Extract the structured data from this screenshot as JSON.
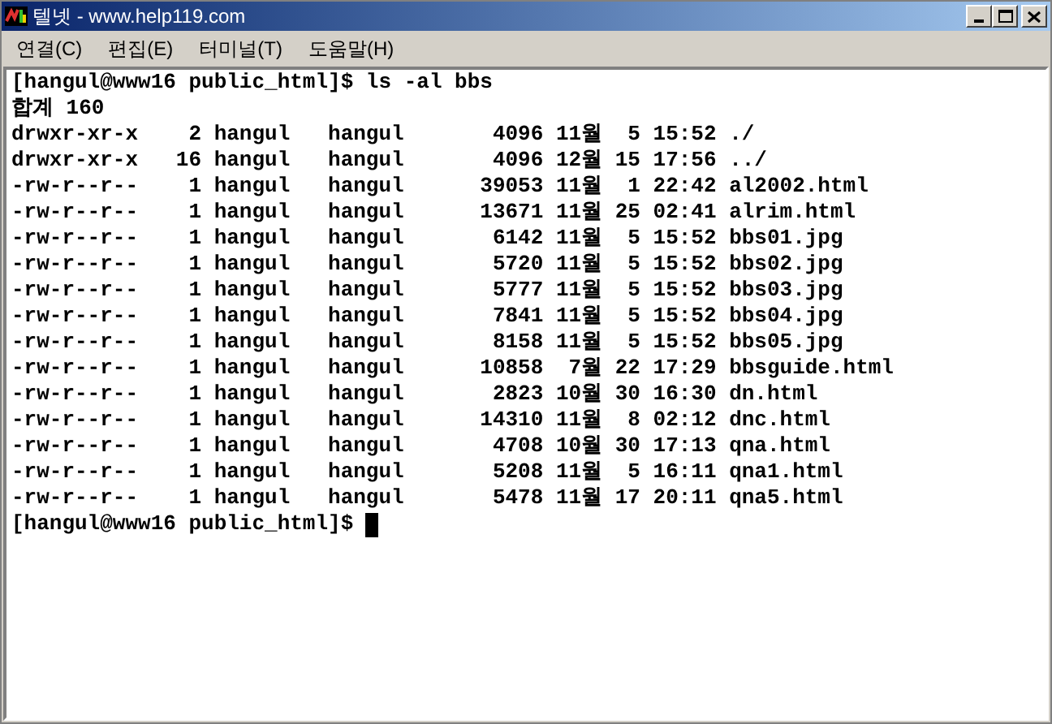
{
  "window": {
    "title": "텔넷 - www.help119.com"
  },
  "menu": [
    {
      "label": "연결(C)"
    },
    {
      "label": "편집(E)"
    },
    {
      "label": "터미널(T)"
    },
    {
      "label": "도움말(H)"
    }
  ],
  "terminal": {
    "lines": [
      "[hangul@www16 public_html]$ ls -al bbs",
      "합계 160",
      "drwxr-xr-x    2 hangul   hangul       4096 11월  5 15:52 ./",
      "drwxr-xr-x   16 hangul   hangul       4096 12월 15 17:56 ../",
      "-rw-r--r--    1 hangul   hangul      39053 11월  1 22:42 al2002.html",
      "-rw-r--r--    1 hangul   hangul      13671 11월 25 02:41 alrim.html",
      "-rw-r--r--    1 hangul   hangul       6142 11월  5 15:52 bbs01.jpg",
      "-rw-r--r--    1 hangul   hangul       5720 11월  5 15:52 bbs02.jpg",
      "-rw-r--r--    1 hangul   hangul       5777 11월  5 15:52 bbs03.jpg",
      "-rw-r--r--    1 hangul   hangul       7841 11월  5 15:52 bbs04.jpg",
      "-rw-r--r--    1 hangul   hangul       8158 11월  5 15:52 bbs05.jpg",
      "-rw-r--r--    1 hangul   hangul      10858  7월 22 17:29 bbsguide.html",
      "-rw-r--r--    1 hangul   hangul       2823 10월 30 16:30 dn.html",
      "-rw-r--r--    1 hangul   hangul      14310 11월  8 02:12 dnc.html",
      "-rw-r--r--    1 hangul   hangul       4708 10월 30 17:13 qna.html",
      "-rw-r--r--    1 hangul   hangul       5208 11월  5 16:11 qna1.html",
      "-rw-r--r--    1 hangul   hangul       5478 11월 17 20:11 qna5.html"
    ],
    "prompt": "[hangul@www16 public_html]$ "
  }
}
